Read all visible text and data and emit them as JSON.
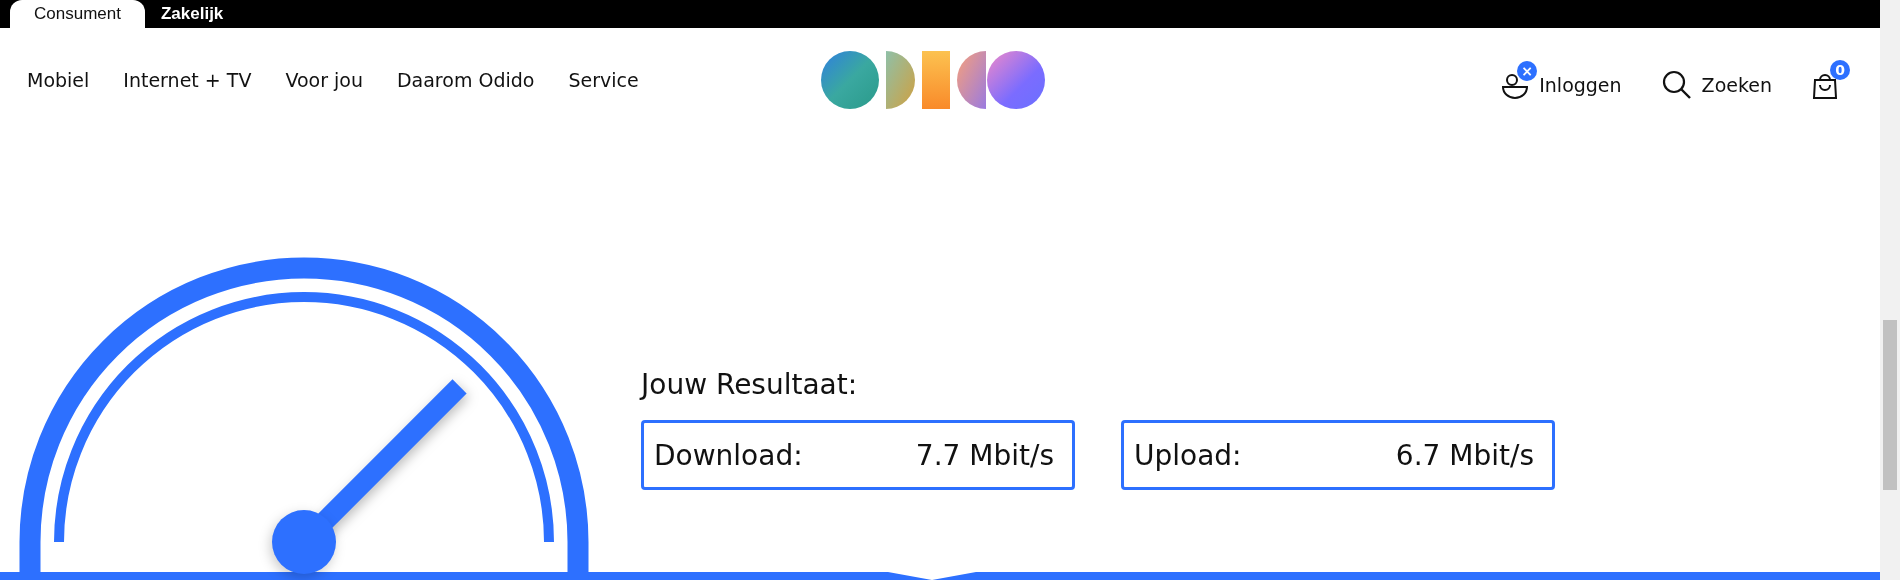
{
  "top_tabs": [
    {
      "label": "Consument",
      "selected": true
    },
    {
      "label": "Zakelijk",
      "selected": false
    }
  ],
  "nav": {
    "items": [
      "Mobiel",
      "Internet + TV",
      "Voor jou",
      "Daarom Odido",
      "Service"
    ],
    "login": {
      "label": "Inloggen",
      "badge": "×"
    },
    "search": {
      "label": "Zoeken"
    },
    "cart": {
      "badge": "0"
    }
  },
  "result": {
    "title": "Jouw Resultaat:",
    "items": [
      {
        "label": "Download:",
        "value": "7.7 Mbit/s"
      },
      {
        "label": "Upload:",
        "value": "6.7 Mbit/s"
      }
    ]
  }
}
